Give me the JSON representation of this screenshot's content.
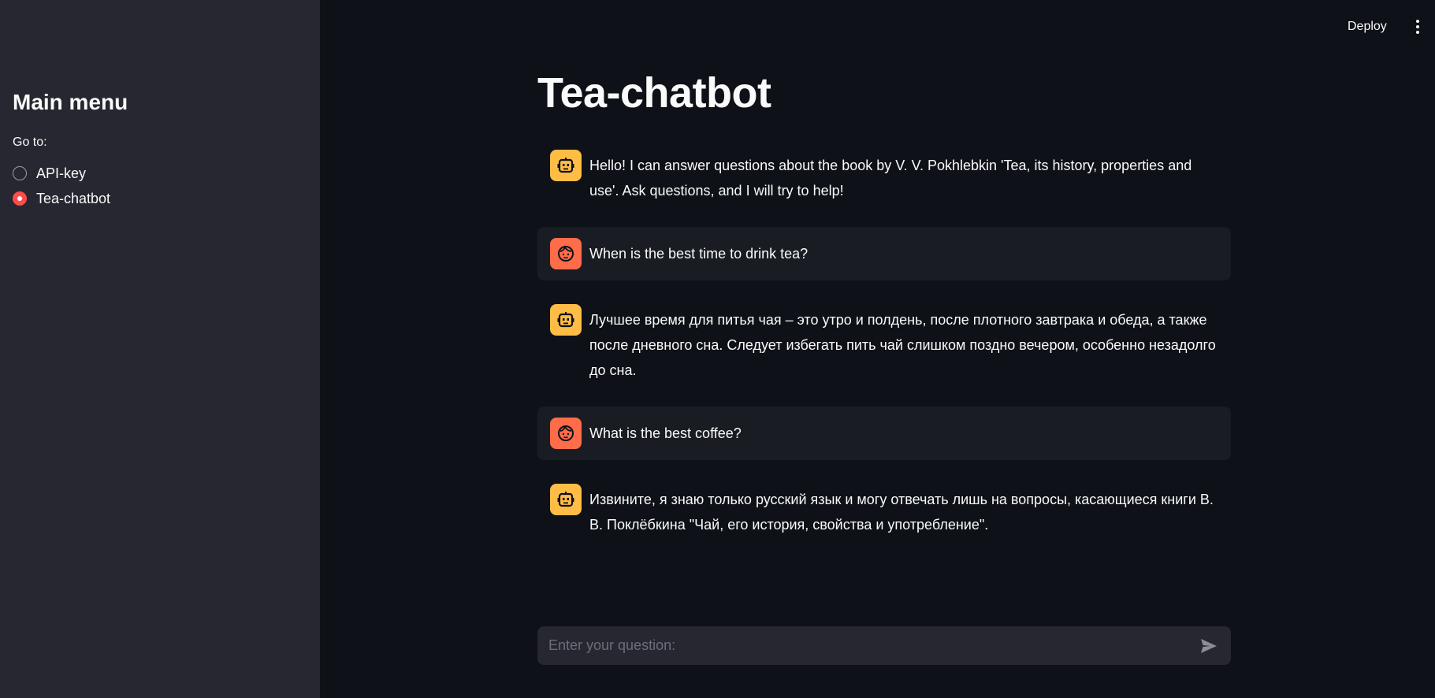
{
  "header": {
    "deploy_label": "Deploy",
    "menu_icon": "more-vert-icon"
  },
  "sidebar": {
    "title": "Main menu",
    "radio_label": "Go to:",
    "options": [
      {
        "label": "API-key",
        "selected": false
      },
      {
        "label": "Tea-chatbot",
        "selected": true
      }
    ],
    "accent_color": "#ff4b4b"
  },
  "main": {
    "title": "Tea-chatbot",
    "messages": [
      {
        "role": "assistant",
        "avatar_icon": "robot-icon",
        "text": "Hello! I can answer questions about the book by V. V. Pokhlebkin 'Tea, its history, properties and use'. Ask questions, and I will try to help!"
      },
      {
        "role": "user",
        "avatar_icon": "face-icon",
        "text": "When is the best time to drink tea?"
      },
      {
        "role": "assistant",
        "avatar_icon": "robot-icon",
        "text": "Лучшее время для питья чая – это утро и полдень, после плотного завтрака и обеда, а также после дневного сна. Следует избегать пить чай слишком поздно вечером, особенно незадолго до сна."
      },
      {
        "role": "user",
        "avatar_icon": "face-icon",
        "text": "What is the best coffee?"
      },
      {
        "role": "assistant",
        "avatar_icon": "robot-icon",
        "text": "Извините, я знаю только русский язык и могу отвечать лишь на вопросы, касающиеся книги В. В. Поклёбкина \"Чай, его история, свойства и употребление\"."
      }
    ],
    "input": {
      "placeholder": "Enter your question:",
      "value": ""
    }
  },
  "colors": {
    "background": "#0e1117",
    "sidebar": "#262730",
    "bot_avatar": "#ffbd45",
    "user_avatar": "#ff6c4a",
    "user_message_bg": "#1a1c24"
  }
}
